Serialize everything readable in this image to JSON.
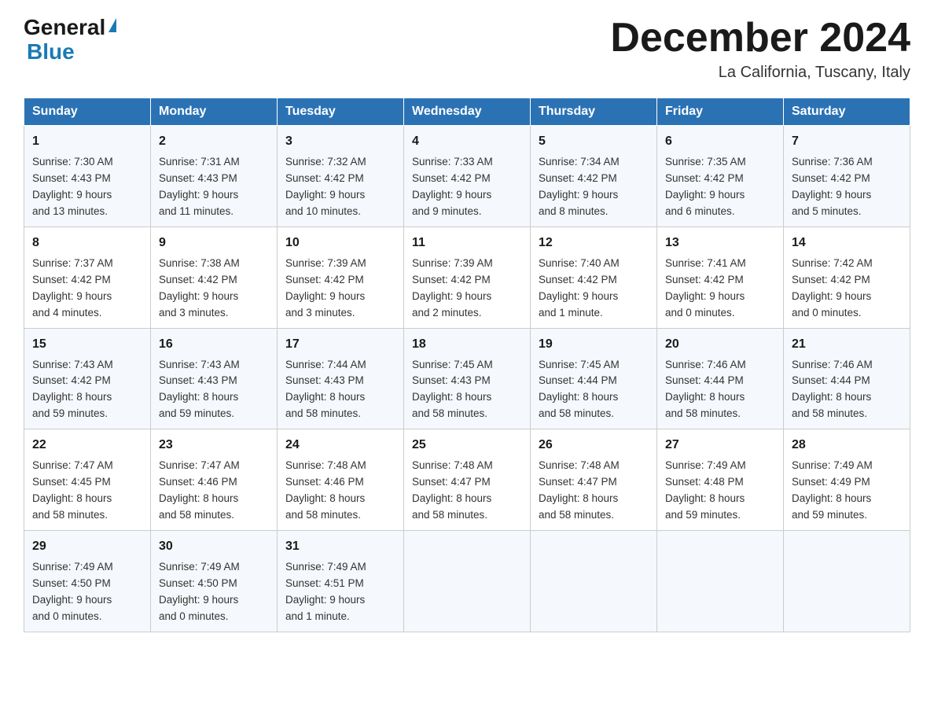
{
  "logo": {
    "general": "General",
    "blue": "Blue"
  },
  "header": {
    "month": "December 2024",
    "location": "La California, Tuscany, Italy"
  },
  "days_of_week": [
    "Sunday",
    "Monday",
    "Tuesday",
    "Wednesday",
    "Thursday",
    "Friday",
    "Saturday"
  ],
  "weeks": [
    [
      {
        "day": "1",
        "sunrise": "7:30 AM",
        "sunset": "4:43 PM",
        "daylight": "9 hours and 13 minutes."
      },
      {
        "day": "2",
        "sunrise": "7:31 AM",
        "sunset": "4:43 PM",
        "daylight": "9 hours and 11 minutes."
      },
      {
        "day": "3",
        "sunrise": "7:32 AM",
        "sunset": "4:42 PM",
        "daylight": "9 hours and 10 minutes."
      },
      {
        "day": "4",
        "sunrise": "7:33 AM",
        "sunset": "4:42 PM",
        "daylight": "9 hours and 9 minutes."
      },
      {
        "day": "5",
        "sunrise": "7:34 AM",
        "sunset": "4:42 PM",
        "daylight": "9 hours and 8 minutes."
      },
      {
        "day": "6",
        "sunrise": "7:35 AM",
        "sunset": "4:42 PM",
        "daylight": "9 hours and 6 minutes."
      },
      {
        "day": "7",
        "sunrise": "7:36 AM",
        "sunset": "4:42 PM",
        "daylight": "9 hours and 5 minutes."
      }
    ],
    [
      {
        "day": "8",
        "sunrise": "7:37 AM",
        "sunset": "4:42 PM",
        "daylight": "9 hours and 4 minutes."
      },
      {
        "day": "9",
        "sunrise": "7:38 AM",
        "sunset": "4:42 PM",
        "daylight": "9 hours and 3 minutes."
      },
      {
        "day": "10",
        "sunrise": "7:39 AM",
        "sunset": "4:42 PM",
        "daylight": "9 hours and 3 minutes."
      },
      {
        "day": "11",
        "sunrise": "7:39 AM",
        "sunset": "4:42 PM",
        "daylight": "9 hours and 2 minutes."
      },
      {
        "day": "12",
        "sunrise": "7:40 AM",
        "sunset": "4:42 PM",
        "daylight": "9 hours and 1 minute."
      },
      {
        "day": "13",
        "sunrise": "7:41 AM",
        "sunset": "4:42 PM",
        "daylight": "9 hours and 0 minutes."
      },
      {
        "day": "14",
        "sunrise": "7:42 AM",
        "sunset": "4:42 PM",
        "daylight": "9 hours and 0 minutes."
      }
    ],
    [
      {
        "day": "15",
        "sunrise": "7:43 AM",
        "sunset": "4:42 PM",
        "daylight": "8 hours and 59 minutes."
      },
      {
        "day": "16",
        "sunrise": "7:43 AM",
        "sunset": "4:43 PM",
        "daylight": "8 hours and 59 minutes."
      },
      {
        "day": "17",
        "sunrise": "7:44 AM",
        "sunset": "4:43 PM",
        "daylight": "8 hours and 58 minutes."
      },
      {
        "day": "18",
        "sunrise": "7:45 AM",
        "sunset": "4:43 PM",
        "daylight": "8 hours and 58 minutes."
      },
      {
        "day": "19",
        "sunrise": "7:45 AM",
        "sunset": "4:44 PM",
        "daylight": "8 hours and 58 minutes."
      },
      {
        "day": "20",
        "sunrise": "7:46 AM",
        "sunset": "4:44 PM",
        "daylight": "8 hours and 58 minutes."
      },
      {
        "day": "21",
        "sunrise": "7:46 AM",
        "sunset": "4:44 PM",
        "daylight": "8 hours and 58 minutes."
      }
    ],
    [
      {
        "day": "22",
        "sunrise": "7:47 AM",
        "sunset": "4:45 PM",
        "daylight": "8 hours and 58 minutes."
      },
      {
        "day": "23",
        "sunrise": "7:47 AM",
        "sunset": "4:46 PM",
        "daylight": "8 hours and 58 minutes."
      },
      {
        "day": "24",
        "sunrise": "7:48 AM",
        "sunset": "4:46 PM",
        "daylight": "8 hours and 58 minutes."
      },
      {
        "day": "25",
        "sunrise": "7:48 AM",
        "sunset": "4:47 PM",
        "daylight": "8 hours and 58 minutes."
      },
      {
        "day": "26",
        "sunrise": "7:48 AM",
        "sunset": "4:47 PM",
        "daylight": "8 hours and 58 minutes."
      },
      {
        "day": "27",
        "sunrise": "7:49 AM",
        "sunset": "4:48 PM",
        "daylight": "8 hours and 59 minutes."
      },
      {
        "day": "28",
        "sunrise": "7:49 AM",
        "sunset": "4:49 PM",
        "daylight": "8 hours and 59 minutes."
      }
    ],
    [
      {
        "day": "29",
        "sunrise": "7:49 AM",
        "sunset": "4:50 PM",
        "daylight": "9 hours and 0 minutes."
      },
      {
        "day": "30",
        "sunrise": "7:49 AM",
        "sunset": "4:50 PM",
        "daylight": "9 hours and 0 minutes."
      },
      {
        "day": "31",
        "sunrise": "7:49 AM",
        "sunset": "4:51 PM",
        "daylight": "9 hours and 1 minute."
      },
      null,
      null,
      null,
      null
    ]
  ],
  "labels": {
    "sunrise": "Sunrise:",
    "sunset": "Sunset:",
    "daylight": "Daylight:"
  }
}
